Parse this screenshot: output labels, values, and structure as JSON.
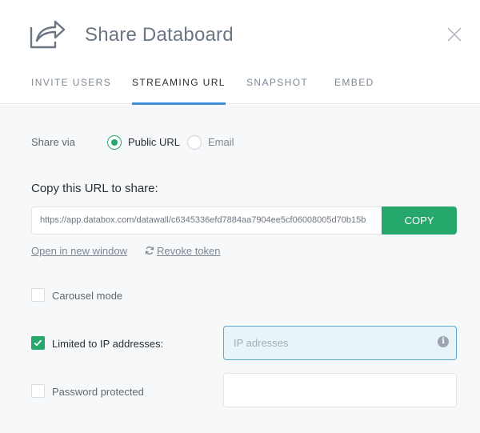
{
  "header": {
    "title": "Share Databoard",
    "icon": "share-icon",
    "close_icon": "close-icon"
  },
  "tabs": [
    {
      "label": "INVITE USERS",
      "active": false
    },
    {
      "label": "STREAMING URL",
      "active": true
    },
    {
      "label": "SNAPSHOT",
      "active": false
    },
    {
      "label": "EMBED",
      "active": false
    }
  ],
  "share_via": {
    "label": "Share via",
    "options": [
      {
        "label": "Public URL",
        "selected": true
      },
      {
        "label": "Email",
        "selected": false
      }
    ]
  },
  "copy_section": {
    "heading": "Copy this URL to share:",
    "url": "https://app.databox.com/datawall/c6345336efd7884aa7904ee5cf06008005d70b15b",
    "copy_label": "COPY"
  },
  "links": {
    "open_new_window": "Open in new window",
    "revoke_token": "Revoke token"
  },
  "options": {
    "carousel": {
      "label": "Carousel mode",
      "checked": false
    },
    "limited_ip": {
      "label": "Limited to IP addresses:",
      "checked": true,
      "placeholder": "IP adresses"
    },
    "password": {
      "label": "Password protected",
      "checked": false,
      "value": ""
    }
  },
  "colors": {
    "accent_green": "#26a86c",
    "tab_underline": "#3a8fd8",
    "input_focus_border": "#5aa9cf"
  }
}
